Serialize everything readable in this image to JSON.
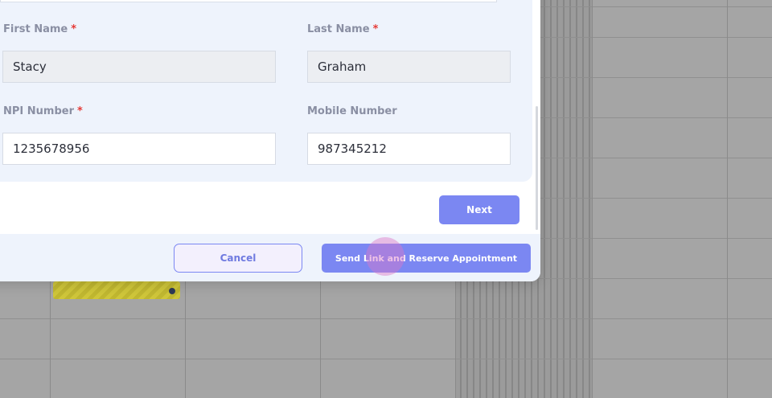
{
  "form": {
    "first_name": {
      "label": "First Name",
      "required_mark": "*",
      "value": "Stacy"
    },
    "last_name": {
      "label": "Last Name",
      "required_mark": "*",
      "value": "Graham"
    },
    "npi_number": {
      "label": "NPI Number",
      "required_mark": "*",
      "value": "1235678956"
    },
    "mobile_number": {
      "label": "Mobile Number",
      "value": "987345212"
    }
  },
  "buttons": {
    "next": "Next",
    "cancel": "Cancel",
    "send": "Send Link and Reserve Appointment"
  },
  "colors": {
    "accent": "#7b87f2",
    "required": "#e53935",
    "panel_bg": "#eef3fc",
    "event_chip": "#cfc63a"
  }
}
